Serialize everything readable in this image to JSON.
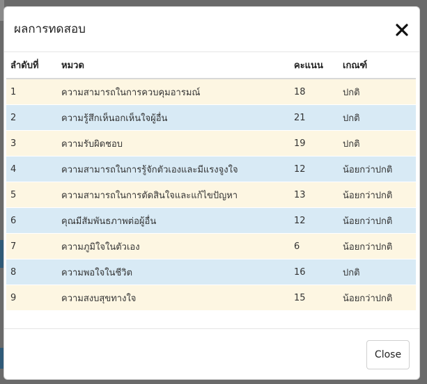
{
  "modal": {
    "title": "ผลการทดสอบ",
    "close_button_label": "Close"
  },
  "table": {
    "headers": [
      "ลำดับที่",
      "หมวด",
      "คะแนน",
      "เกณฑ์"
    ],
    "rows": [
      {
        "no": "1",
        "category": "ความสามารถในการควบคุมอารมณ์",
        "score": "18",
        "criteria": "ปกติ"
      },
      {
        "no": "2",
        "category": "ความรู้สึกเห็นอกเห็นใจผู้อื่น",
        "score": "21",
        "criteria": "ปกติ"
      },
      {
        "no": "3",
        "category": "ความรับผิดชอบ",
        "score": "19",
        "criteria": "ปกติ"
      },
      {
        "no": "4",
        "category": "ความสามารถในการรู้จักตัวเองและมีแรงจูงใจ",
        "score": "12",
        "criteria": "น้อยกว่าปกติ"
      },
      {
        "no": "5",
        "category": "ความสามารถในการตัดสินใจและแก้ไขปัญหา",
        "score": "13",
        "criteria": "น้อยกว่าปกติ"
      },
      {
        "no": "6",
        "category": "คุณมีสัมพันธภาพต่อผู้อื่น",
        "score": "12",
        "criteria": "น้อยกว่าปกติ"
      },
      {
        "no": "7",
        "category": "ความภูมิใจในตัวเอง",
        "score": "6",
        "criteria": "น้อยกว่าปกติ"
      },
      {
        "no": "8",
        "category": "ความพอใจในชีวิต",
        "score": "16",
        "criteria": "ปกติ"
      },
      {
        "no": "9",
        "category": "ความสงบสุขทางใจ",
        "score": "15",
        "criteria": "น้อยกว่าปกติ"
      }
    ]
  },
  "colors": {
    "row_odd": "#fdf6e2",
    "row_even": "#d8eaf5"
  },
  "icons": {
    "close": "close-icon"
  }
}
